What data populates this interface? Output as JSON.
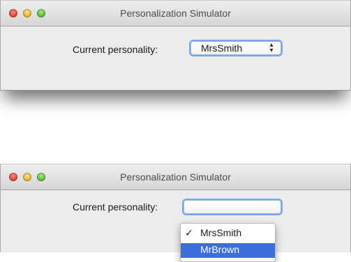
{
  "window1": {
    "title": "Personalization Simulator",
    "label": "Current personality:",
    "popup_value": "MrsSmith",
    "popup_arrows_glyph": "⬍"
  },
  "window2": {
    "title": "Personalization Simulator",
    "label": "Current personality:",
    "popup_value": "",
    "menu": {
      "items": [
        {
          "label": "MrsSmith",
          "check": "✓",
          "selected": true,
          "highlighted": false
        },
        {
          "label": "MrBrown",
          "check": "",
          "selected": false,
          "highlighted": true
        }
      ]
    }
  },
  "colors": {
    "window_bg": "#ececec",
    "highlight": "#3e6fd8",
    "focus_ring": "#77a9e6"
  }
}
